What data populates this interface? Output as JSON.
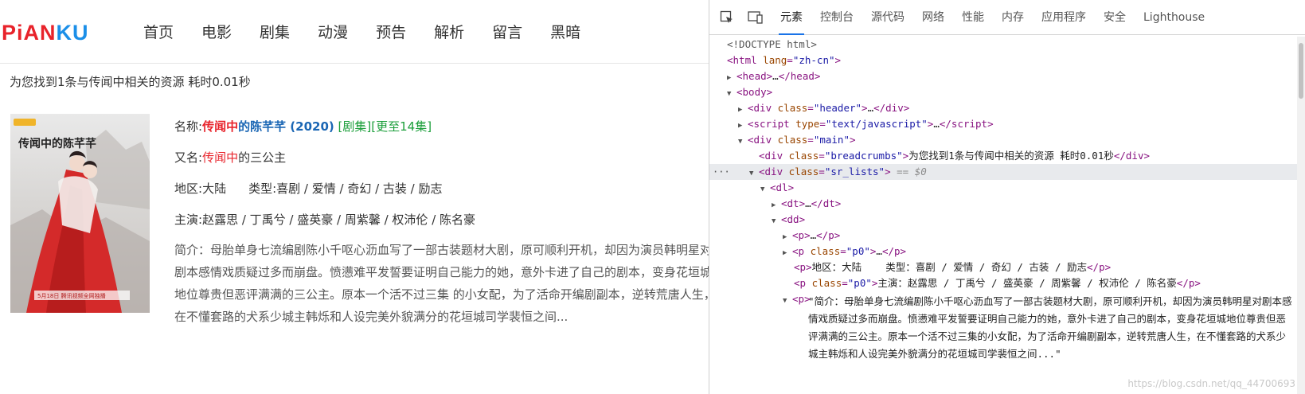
{
  "site": {
    "logo_part1": "PiAN",
    "logo_part2": "KU",
    "nav": [
      "首页",
      "电影",
      "剧集",
      "动漫",
      "预告",
      "解析",
      "留言",
      "黑暗"
    ],
    "breadcrumbs": "为您找到1条与传闻中相关的资源 耗时0.01秒",
    "result": {
      "name_label": "名称:",
      "name_hl": "传闻中",
      "name_rest": "的陈芊芊 (2020)",
      "name_cat": "[剧集]",
      "name_status": "[更至14集]",
      "alias_label": "又名:",
      "alias_hl": "传闻中",
      "alias_rest": "的三公主",
      "region_label": "地区:",
      "region": "大陆",
      "type_label": "类型:",
      "types": "喜剧 / 爱情 / 奇幻 / 古装 / 励志",
      "cast_label": "主演:",
      "cast": "赵露思 / 丁禹兮 / 盛英豪 / 周紫馨 / 权沛伦 / 陈名豪",
      "desc": "简介：母胎单身七流编剧陈小千呕心沥血写了一部古装题材大剧，原可顺利开机，却因为演员韩明星对剧本感情戏质疑过多而崩盘。愤懑难平发誓要证明自己能力的她，意外卡进了自己的剧本，变身花垣城地位尊贵但恶评满满的三公主。原本一个活不过三集 的小女配，为了活命开编剧副本，逆转荒唐人生，在不懂套路的犬系少城主韩烁和人设完美外貌满分的花垣城司学裴恒之间..."
    },
    "poster_caption": "5月18日 腾讯视频全网独播",
    "poster_title": "传闻中的陈芊芊"
  },
  "devtools": {
    "tabs": [
      "元素",
      "控制台",
      "源代码",
      "网络",
      "性能",
      "内存",
      "应用程序",
      "安全",
      "Lighthouse"
    ],
    "active_tab": "元素",
    "tree": {
      "doctype": "<!DOCTYPE html>",
      "html_tag": "html",
      "html_attr": "lang",
      "html_val": "\"zh-cn\"",
      "head": "head",
      "head_dots": "…",
      "body": "body",
      "div": "div",
      "div_class": "class",
      "header_val": "\"header\"",
      "script": "script",
      "script_type": "type",
      "script_val": "\"text/javascript\"",
      "main_val": "\"main\"",
      "breadcrumbs_val": "\"breadcrumbs\"",
      "breadcrumbs_text": "为您找到1条与传闻中相关的资源 耗时0.01秒",
      "srlists_val": "\"sr_lists\"",
      "sel_comment": "== $0",
      "dl": "dl",
      "dt": "dt",
      "dd": "dd",
      "p": "p",
      "p0_val": "\"p0\"",
      "region_text": "地区：大陆    类型：喜剧 / 爱情 / 奇幻 / 古装 / 励志",
      "cast_text": "主演：赵露思 / 丁禹兮 / 盛英豪 / 周紫馨 / 权沛伦 / 陈名豪",
      "desc_text": "\"简介：母胎单身七流编剧陈小千呕心沥血写了一部古装题材大剧，原可顺利开机，却因为演员韩明星对剧本感情戏质疑过多而崩盘。愤懑难平发誓要证明自己能力的她，意外卡进了自己的剧本，变身花垣城地位尊贵但恶评满满的三公主。原本一个活不过三集的小女配，为了活命开编剧副本，逆转荒唐人生，在不懂套路的犬系少城主韩烁和人设完美外貌满分的花垣城司学裴恒之间...\"",
      "more_dots": "…",
      "close_p": "</p>"
    },
    "watermark": "https://blog.csdn.net/qq_44700693"
  }
}
